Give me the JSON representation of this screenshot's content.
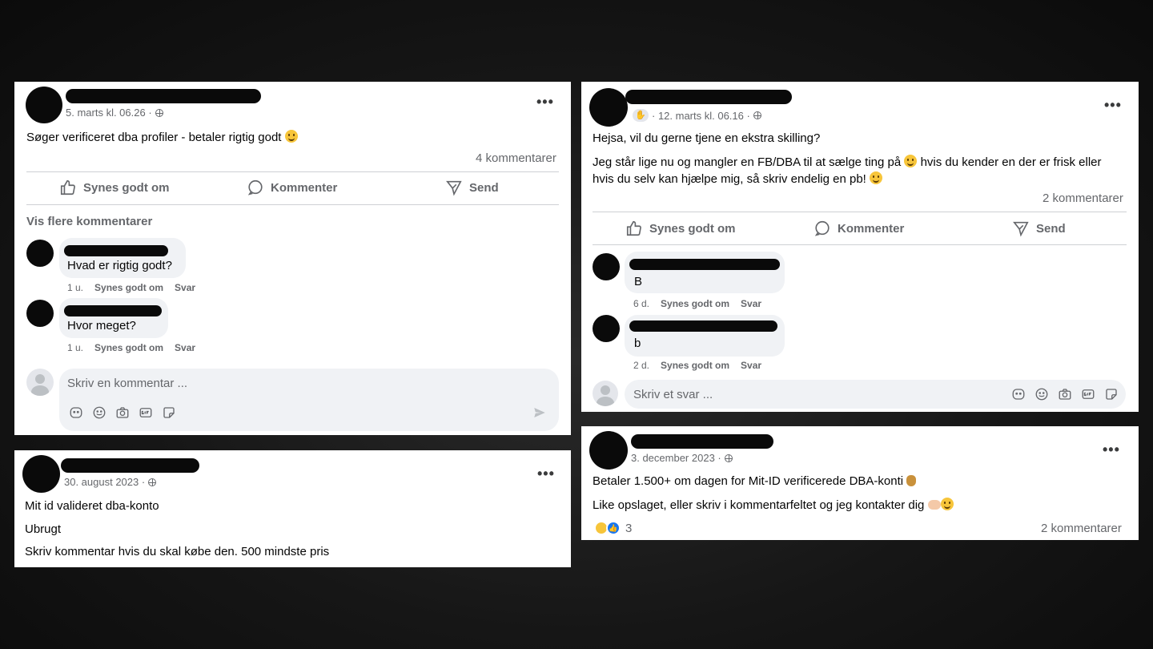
{
  "post1": {
    "meta": "5. marts kl. 06.26 ·",
    "body": "Søger verificeret dba profiler - betaler rigtig godt",
    "comment_count": "4 kommentarer",
    "like_label": "Synes godt om",
    "comment_label": "Kommenter",
    "send_label": "Send",
    "more_comments": "Vis flere kommentarer",
    "comments": [
      {
        "text": "Hvad er rigtig godt?",
        "age": "1 u.",
        "like": "Synes godt om",
        "reply": "Svar"
      },
      {
        "text": "Hvor meget?",
        "age": "1 u.",
        "like": "Synes godt om",
        "reply": "Svar"
      }
    ],
    "input_placeholder": "Skriv en kommentar ..."
  },
  "post2": {
    "meta": "· 12. marts kl. 06.16 ·",
    "line1": "Hejsa, vil du gerne tjene en ekstra skilling?",
    "line2": "Jeg står lige nu og mangler en FB/DBA til at sælge ting på",
    "line2b": "hvis du kender en der er frisk eller",
    "line3": "hvis du selv kan hjælpe mig, så skriv endelig en pb!",
    "comment_count": "2 kommentarer",
    "like_label": "Synes godt om",
    "comment_label": "Kommenter",
    "send_label": "Send",
    "comments": [
      {
        "text": "B",
        "age": "6 d.",
        "like": "Synes godt om",
        "reply": "Svar"
      },
      {
        "text": "b",
        "age": "2 d.",
        "like": "Synes godt om",
        "reply": "Svar"
      }
    ],
    "input_placeholder": "Skriv et svar ..."
  },
  "post3": {
    "meta": "30. august 2023 ·",
    "line1": "Mit id valideret dba-konto",
    "line2": "Ubrugt",
    "line3": "Skriv kommentar hvis du skal købe den. 500 mindste pris"
  },
  "post4": {
    "meta": "3. december 2023 ·",
    "line1": "Betaler 1.500+ om dagen for Mit-ID verificerede DBA-konti",
    "line2": "Like opslaget, eller skriv i kommentarfeltet og jeg kontakter dig",
    "reaction_count": "3",
    "comment_count": "2 kommentarer"
  },
  "icons": {
    "menu": "more-options-icon",
    "like": "thumbs-up-icon",
    "comment": "speech-bubble-icon",
    "send": "paper-plane-icon"
  },
  "colors": {
    "background": "#141414",
    "card": "#ffffff",
    "secondary_text": "#65676b",
    "bubble": "#f0f2f5",
    "like_blue": "#1877f2"
  }
}
